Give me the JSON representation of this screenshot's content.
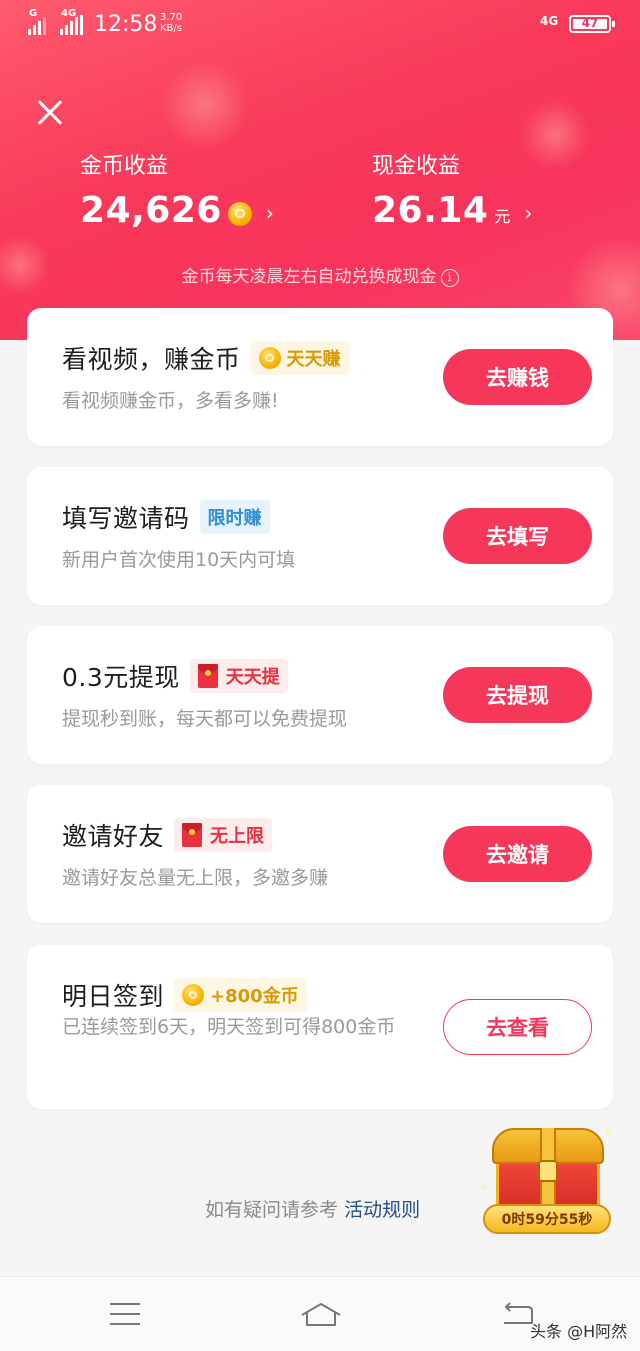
{
  "status_bar": {
    "sim1_label": "G",
    "sim2_label": "4G",
    "time": "12:58",
    "speed_value": "3.70",
    "speed_unit": "KB/s",
    "network": "4G",
    "battery": "47"
  },
  "header": {
    "close_icon": "close-icon",
    "coin_income": {
      "label": "金币收益",
      "value": "24,626",
      "icon": "coin-icon"
    },
    "cash_income": {
      "label": "现金收益",
      "value": "26.14",
      "unit": "元"
    },
    "chevron": "›",
    "hint": "金币每天凌晨左右自动兑换成现金",
    "info_glyph": "i"
  },
  "tasks": [
    {
      "title": "看视频，赚金币",
      "badge": "天天赚",
      "badge_icon": "coin-icon",
      "subtitle": "看视频赚金币，多看多赚!",
      "button": "去赚钱"
    },
    {
      "title": "填写邀请码",
      "badge": "限时赚",
      "subtitle": "新用户首次使用10天内可填",
      "button": "去填写"
    },
    {
      "title": "0.3元提现",
      "badge": "天天提",
      "badge_icon": "red-envelope-icon",
      "subtitle": "提现秒到账，每天都可以免费提现",
      "button": "去提现"
    },
    {
      "title": "邀请好友",
      "badge": "无上限",
      "badge_icon": "red-envelope-icon",
      "subtitle": "邀请好友总量无上限，多邀多赚",
      "button": "去邀请"
    },
    {
      "title": "明日签到",
      "badge": "+800金币",
      "badge_icon": "coin-icon",
      "subtitle": "已连续签到6天，明天签到可得800金币",
      "button": "去查看"
    }
  ],
  "footer": {
    "text": "如有疑问请参考",
    "link": "活动规则"
  },
  "treasure_chest": {
    "icon": "treasure-chest-icon",
    "timer": "0时59分55秒"
  },
  "navbar": {
    "menu_icon": "menu-icon",
    "home_icon": "home-icon",
    "back_icon": "back-icon"
  },
  "watermark": "头条 @H阿然",
  "colors": {
    "accent": "#f5385a",
    "gold": "#d79a00",
    "blue_badge": "#2e8fd6",
    "red_badge": "#ea2f3f"
  }
}
